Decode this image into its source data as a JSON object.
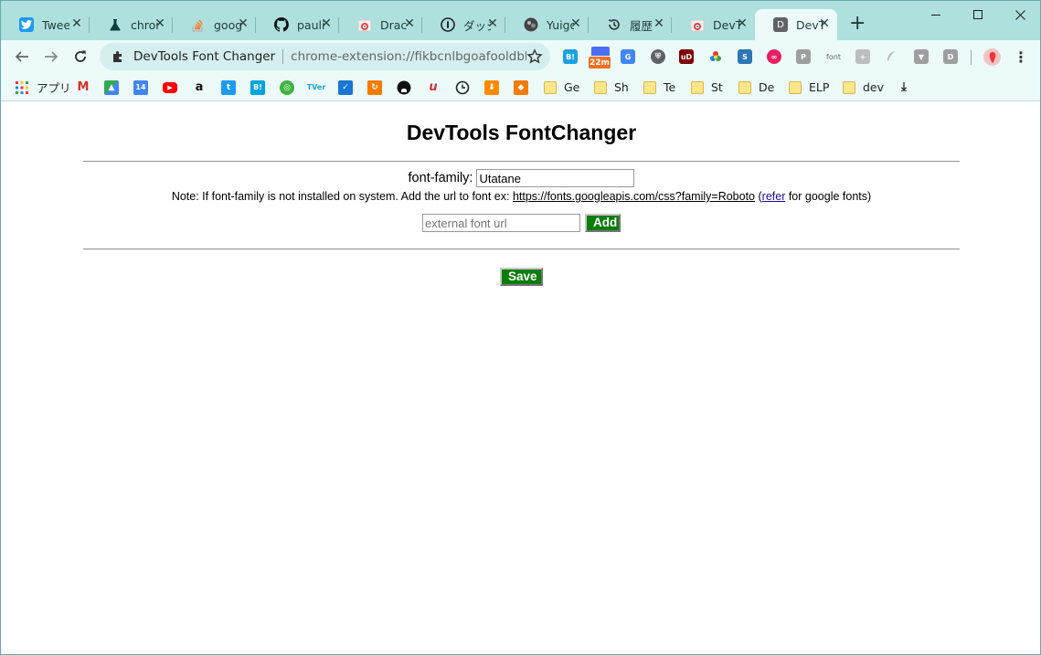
{
  "tabs": [
    {
      "title": "Tweets",
      "icon": "twitter-icon",
      "color": "#1d9bf0"
    },
    {
      "title": "chrome",
      "icon": "flask-icon",
      "color": "#0b3f3d"
    },
    {
      "title": "google",
      "icon": "stackoverflow-icon",
      "color": "#f48024"
    },
    {
      "title": "paulirish",
      "icon": "github-icon",
      "color": "#111111"
    },
    {
      "title": "Dracula",
      "icon": "chrome-store-icon",
      "color": "#e34133"
    },
    {
      "title": "ダッシュボード",
      "icon": "info-circle-icon",
      "color": "#222222"
    },
    {
      "title": "Yuigoto",
      "icon": "avatar-icon",
      "color": "#333333"
    },
    {
      "title": "履歴",
      "icon": "history-icon",
      "color": "#333333"
    },
    {
      "title": "DevTools",
      "icon": "chrome-store-icon",
      "color": "#e34133"
    },
    {
      "title": "DevTools",
      "icon": "d-letter-icon",
      "color": "#5f6368",
      "active": true
    }
  ],
  "toolbar": {
    "site_name": "DevTools Font Changer",
    "url": "chrome-extension://fikbcnlbgoafooldbk..."
  },
  "extensions": {
    "badge_22m": "22m",
    "font_label": "font"
  },
  "bookmarks": {
    "apps_label": "アプリ",
    "folders": [
      "Ge",
      "Sh",
      "Te",
      "St",
      "De",
      "ELP",
      "dev"
    ]
  },
  "page": {
    "heading": "DevTools FontChanger",
    "font_family_label": "font-family:",
    "font_family_value": "Utatane",
    "note_prefix": "Note: If font-family is not installed on system. Add the url to font ex: ",
    "note_link": "https://fonts.googleapis.com/css?family=Roboto",
    "note_open_paren": " (",
    "note_refer": "refer",
    "note_suffix": " for google fonts)",
    "external_placeholder": "external font url",
    "add_label": "Add",
    "save_label": "Save"
  },
  "colors": {
    "tab_strip": "#aee0de",
    "toolbar": "#ecfbfa",
    "button_green": "#0a7d0a"
  }
}
